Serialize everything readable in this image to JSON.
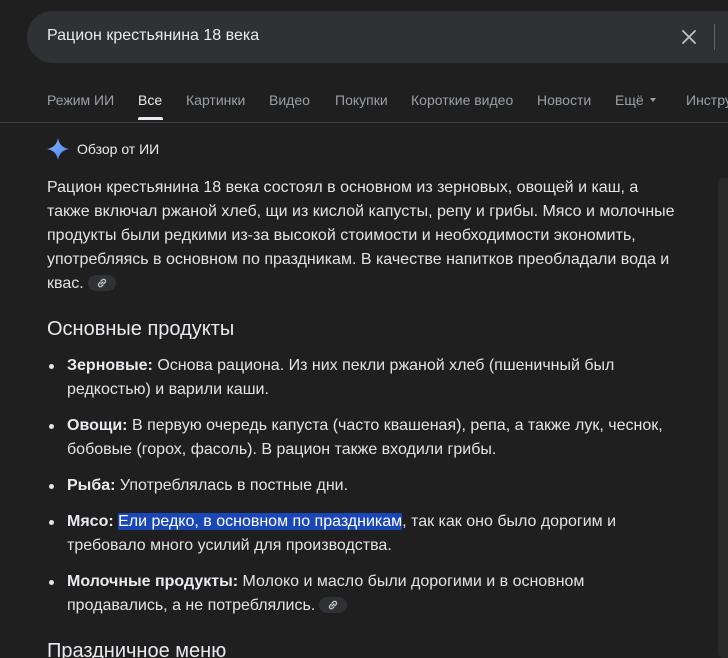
{
  "search": {
    "query": "Рацион крестьянина 18 века"
  },
  "tabs": [
    {
      "label": "Режим ИИ"
    },
    {
      "label": "Все"
    },
    {
      "label": "Картинки"
    },
    {
      "label": "Видео"
    },
    {
      "label": "Покупки"
    },
    {
      "label": "Короткие видео"
    },
    {
      "label": "Новости"
    },
    {
      "label": "Ещё"
    },
    {
      "label": "Инстру"
    }
  ],
  "active_tab": "Все",
  "ai_overview": {
    "title": "Обзор от ИИ",
    "summary_lines": [
      "Рацион крестьянина 18 века состоял в основном из зерновых, овощей и каш, а",
      "также включал ржаной хлеб, щи из кислой капусты, репу и грибы. Мясо и молочные",
      "продукты были редкими из-за высокой стоимости и необходимости экономить,",
      "употребляясь в основном по праздникам. В качестве напитков преобладали вода и",
      "квас."
    ],
    "section_heading": "Основные продукты",
    "items": [
      {
        "term": "Зерновые:",
        "text": "Основа рациона. Из них пекли ржаной хлеб (пшеничный был редкостью) и варили каши."
      },
      {
        "term": "Овощи:",
        "text": "В первую очередь капуста (часто квашеная), репа, а также лук, чеснок, бобовые (горох, фасоль). В рацион также входили грибы."
      },
      {
        "term": "Рыба:",
        "text": "Употреблялась в постные дни."
      },
      {
        "term": "Мясо:",
        "highlighted": "Ели редко, в основном по праздникам",
        "text": ", так как оно было дорогим и требовало много усилий для производства."
      },
      {
        "term": "Молочные продукты:",
        "text": "Молоко и масло были дорогими и в основном продавались, а не потреблялись."
      }
    ],
    "next_heading": "Праздничное меню"
  },
  "colors": {
    "background": "#1f1f1f",
    "search_bg": "#303134",
    "highlight": "#1a47b8",
    "sparkle": "#8ab4f8"
  }
}
